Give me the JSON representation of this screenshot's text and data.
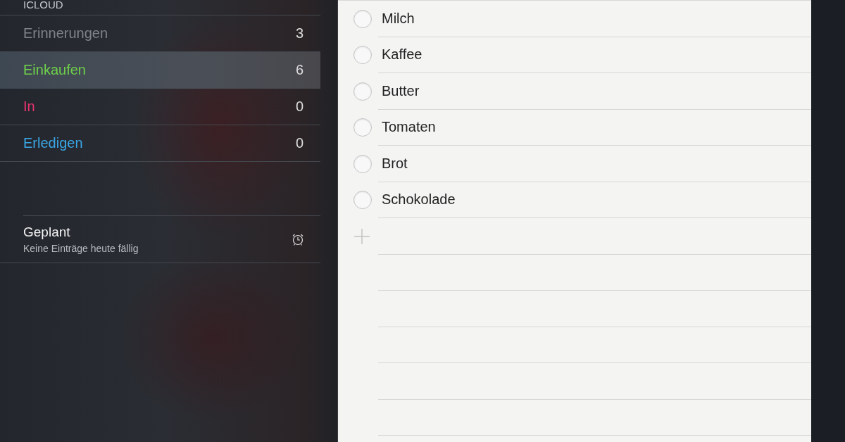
{
  "sidebar": {
    "section_header": "ICLOUD",
    "lists": [
      {
        "name": "Erinnerungen",
        "count": "3",
        "color": "#80838a",
        "selected": false
      },
      {
        "name": "Einkaufen",
        "count": "6",
        "color": "#6fd14a",
        "selected": true
      },
      {
        "name": "In",
        "count": "0",
        "color": "#e8336f",
        "selected": false
      },
      {
        "name": "Erledigen",
        "count": "0",
        "color": "#3aa6e6",
        "selected": false
      }
    ],
    "scheduled": {
      "title": "Geplant",
      "subtitle": "Keine Einträge heute fällig"
    }
  },
  "reminders": [
    {
      "title": "Milch",
      "checked": false
    },
    {
      "title": "Kaffee",
      "checked": false
    },
    {
      "title": "Butter",
      "checked": false
    },
    {
      "title": "Tomaten",
      "checked": false
    },
    {
      "title": "Brot",
      "checked": false
    },
    {
      "title": "Schokolade",
      "checked": false
    }
  ]
}
